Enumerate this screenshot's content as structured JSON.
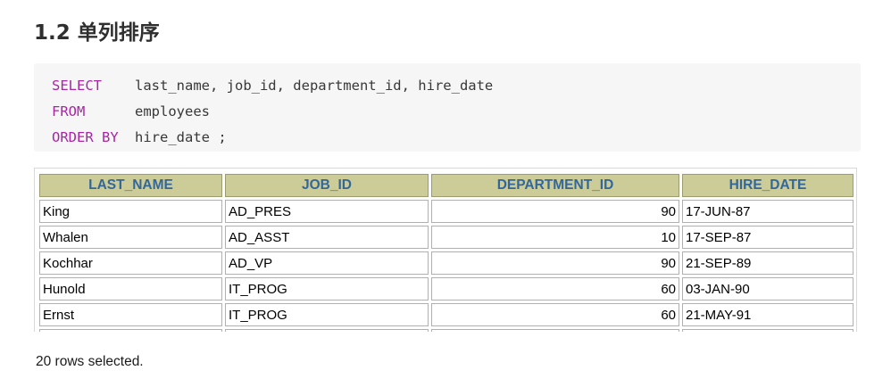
{
  "section": {
    "title": "1.2 单列排序"
  },
  "code": {
    "lines": [
      {
        "keyword": "SELECT",
        "text": "last_name, job_id, department_id, hire_date"
      },
      {
        "keyword": "FROM",
        "text": "employees"
      },
      {
        "keyword": "ORDER BY",
        "text": "hire_date ;"
      }
    ]
  },
  "table": {
    "headers": [
      "LAST_NAME",
      "JOB_ID",
      "DEPARTMENT_ID",
      "HIRE_DATE"
    ],
    "rows": [
      [
        "King",
        "AD_PRES",
        "90",
        "17-JUN-87"
      ],
      [
        "Whalen",
        "AD_ASST",
        "10",
        "17-SEP-87"
      ],
      [
        "Kochhar",
        "AD_VP",
        "90",
        "21-SEP-89"
      ],
      [
        "Hunold",
        "IT_PROG",
        "60",
        "03-JAN-90"
      ],
      [
        "Ernst",
        "IT_PROG",
        "60",
        "21-MAY-91"
      ],
      [
        "",
        "",
        "",
        ""
      ]
    ]
  },
  "footer": {
    "text": "20 rows selected."
  },
  "colors": {
    "keyword": "#a626a4",
    "header_bg": "#cccc99",
    "header_text": "#336699",
    "code_bg": "#f6f6f6"
  }
}
